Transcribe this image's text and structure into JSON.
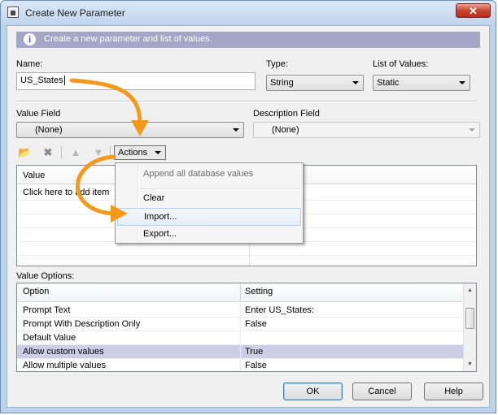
{
  "window": {
    "title": "Create New Parameter",
    "close_glyph": "✕"
  },
  "banner": {
    "text": "Create a new parameter and list of values."
  },
  "name": {
    "label": "Name:",
    "value": "US_States"
  },
  "type": {
    "label": "Type:",
    "value": "String"
  },
  "list_of_values": {
    "label": "List of Values:",
    "value": "Static"
  },
  "value_field": {
    "label": "Value Field",
    "value": "(None)"
  },
  "description_field": {
    "label": "Description Field",
    "value": "(None)"
  },
  "toolbar": {
    "actions_label": "Actions",
    "icons": [
      "open-folder-icon",
      "delete-icon",
      "move-up-icon",
      "move-down-icon"
    ]
  },
  "values_grid": {
    "column": "Value",
    "placeholder_row": "Click here to add item"
  },
  "actions_menu": {
    "items": [
      {
        "label": "Append all database values",
        "enabled": false
      },
      {
        "label": "Clear",
        "enabled": true
      },
      {
        "label": "Import...",
        "enabled": true,
        "highlighted": true
      },
      {
        "label": "Export...",
        "enabled": true
      }
    ]
  },
  "value_options": {
    "label": "Value Options:",
    "columns": [
      "Option",
      "Setting"
    ],
    "rows": [
      {
        "option": "Prompt Text",
        "setting": "Enter US_States:"
      },
      {
        "option": "Prompt With Description Only",
        "setting": "False"
      },
      {
        "option": "Default Value",
        "setting": ""
      },
      {
        "option": "Allow custom values",
        "setting": "True",
        "selected": true
      },
      {
        "option": "Allow multiple values",
        "setting": "False"
      }
    ]
  },
  "buttons": {
    "ok": "OK",
    "cancel": "Cancel",
    "help": "Help"
  },
  "colors": {
    "banner": "#a3a6c4",
    "selected_row": "#cdcde6",
    "arrow": "#f39a1d"
  }
}
